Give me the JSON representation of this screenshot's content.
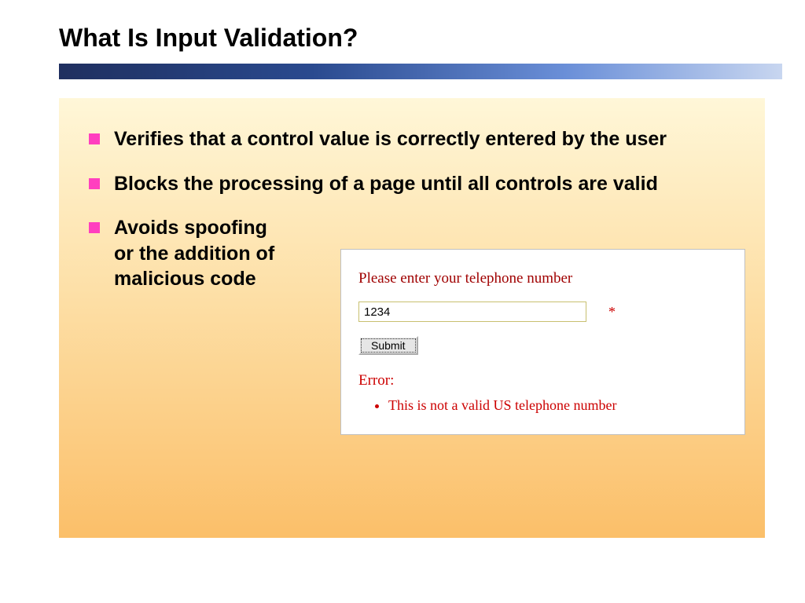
{
  "title": "What Is Input Validation?",
  "bullets": [
    "Verifies that a control value is correctly entered by the user",
    "Blocks the processing of a page until all controls are valid",
    "Avoids spoofing\nor the addition of malicious code"
  ],
  "form": {
    "prompt": "Please enter your telephone number",
    "input_value": "1234",
    "asterisk": "*",
    "submit_label": "Submit",
    "error_label": "Error:",
    "error_item": "This is not a valid US telephone number"
  }
}
